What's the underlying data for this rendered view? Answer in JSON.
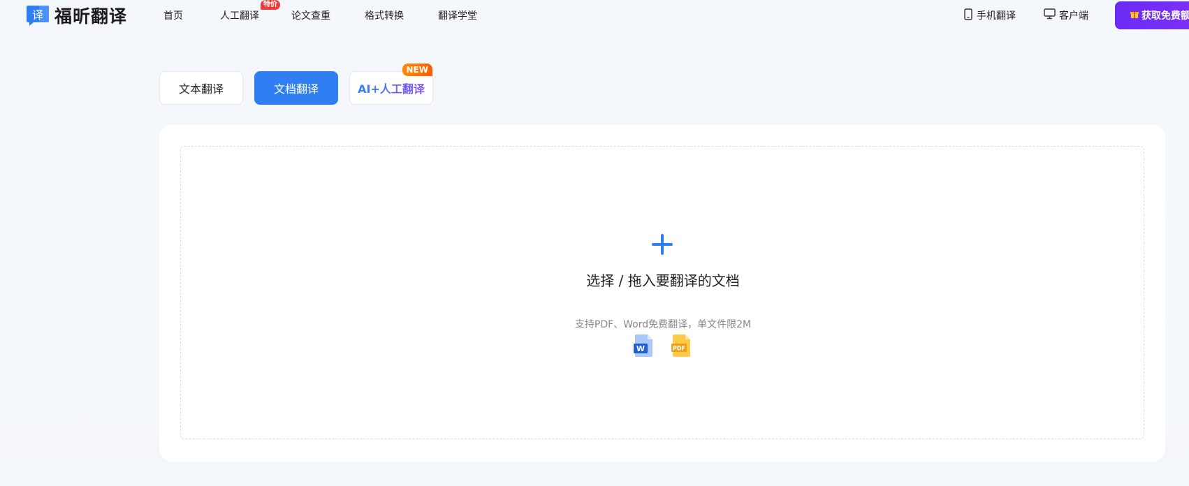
{
  "header": {
    "logo_text": "福昕翻译",
    "logo_glyph": "译",
    "nav": [
      {
        "label": "首页"
      },
      {
        "label": "人工翻译",
        "badge": "特价"
      },
      {
        "label": "论文查重"
      },
      {
        "label": "格式转换"
      },
      {
        "label": "翻译学堂"
      }
    ],
    "mobile_label": "手机翻译",
    "client_label": "客户端",
    "cta_label": "获取免费额"
  },
  "tabs": [
    {
      "label": "文本翻译",
      "active": false
    },
    {
      "label": "文档翻译",
      "active": true
    },
    {
      "label": "AI+人工翻译",
      "badge": "NEW"
    }
  ],
  "upload": {
    "title": "选择 / 拖入要翻译的文档",
    "subtitle": "支持PDF、Word免费翻译，单文件限2M",
    "icons": [
      "word-file-icon",
      "pdf-file-icon"
    ]
  },
  "colors": {
    "accent": "#2f7ff3",
    "cta": "#6a2bf5",
    "badge_red": "#ef3a3a",
    "badge_orange": "#ff6a00"
  }
}
